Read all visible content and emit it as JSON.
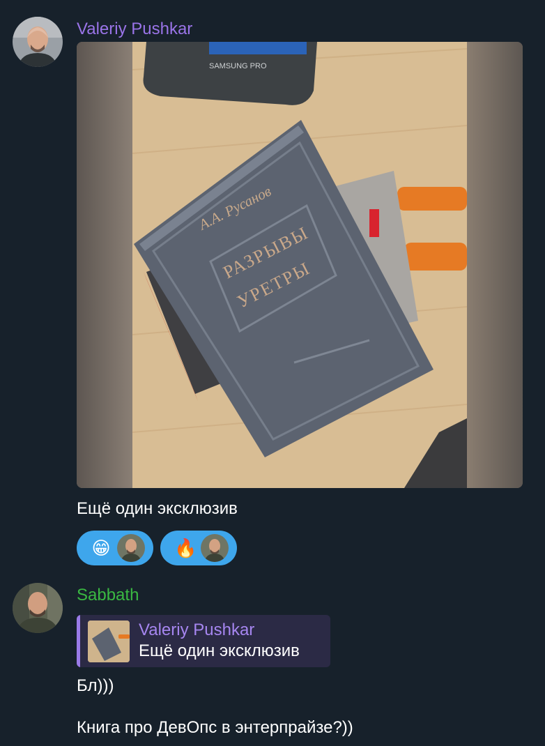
{
  "colors": {
    "background": "#17212b",
    "sender_1": "#9a74e8",
    "sender_2": "#3ab842",
    "reaction_bg": "#3ea6ec",
    "reply_bg": "#2b2a45",
    "reply_accent": "#9a7be8"
  },
  "message_1": {
    "sender": "Valeriy Pushkar",
    "photo": {
      "book_author": "А.А. Русанов",
      "book_title_line1": "РАЗРЫВЫ",
      "book_title_line2": "УРЕТРЫ"
    },
    "caption": "Ещё один эксклюзив",
    "reactions": [
      {
        "emoji": "😁",
        "icon": "grinning-face-emoji"
      },
      {
        "emoji": "🔥",
        "icon": "fire-emoji"
      }
    ]
  },
  "message_2": {
    "sender": "Sabbath",
    "reply": {
      "sender": "Valeriy Pushkar",
      "text": "Ещё один эксклюзив"
    },
    "lines": [
      "Бл)))",
      "Книга про ДевОпс в энтерпрайзе?))"
    ]
  }
}
